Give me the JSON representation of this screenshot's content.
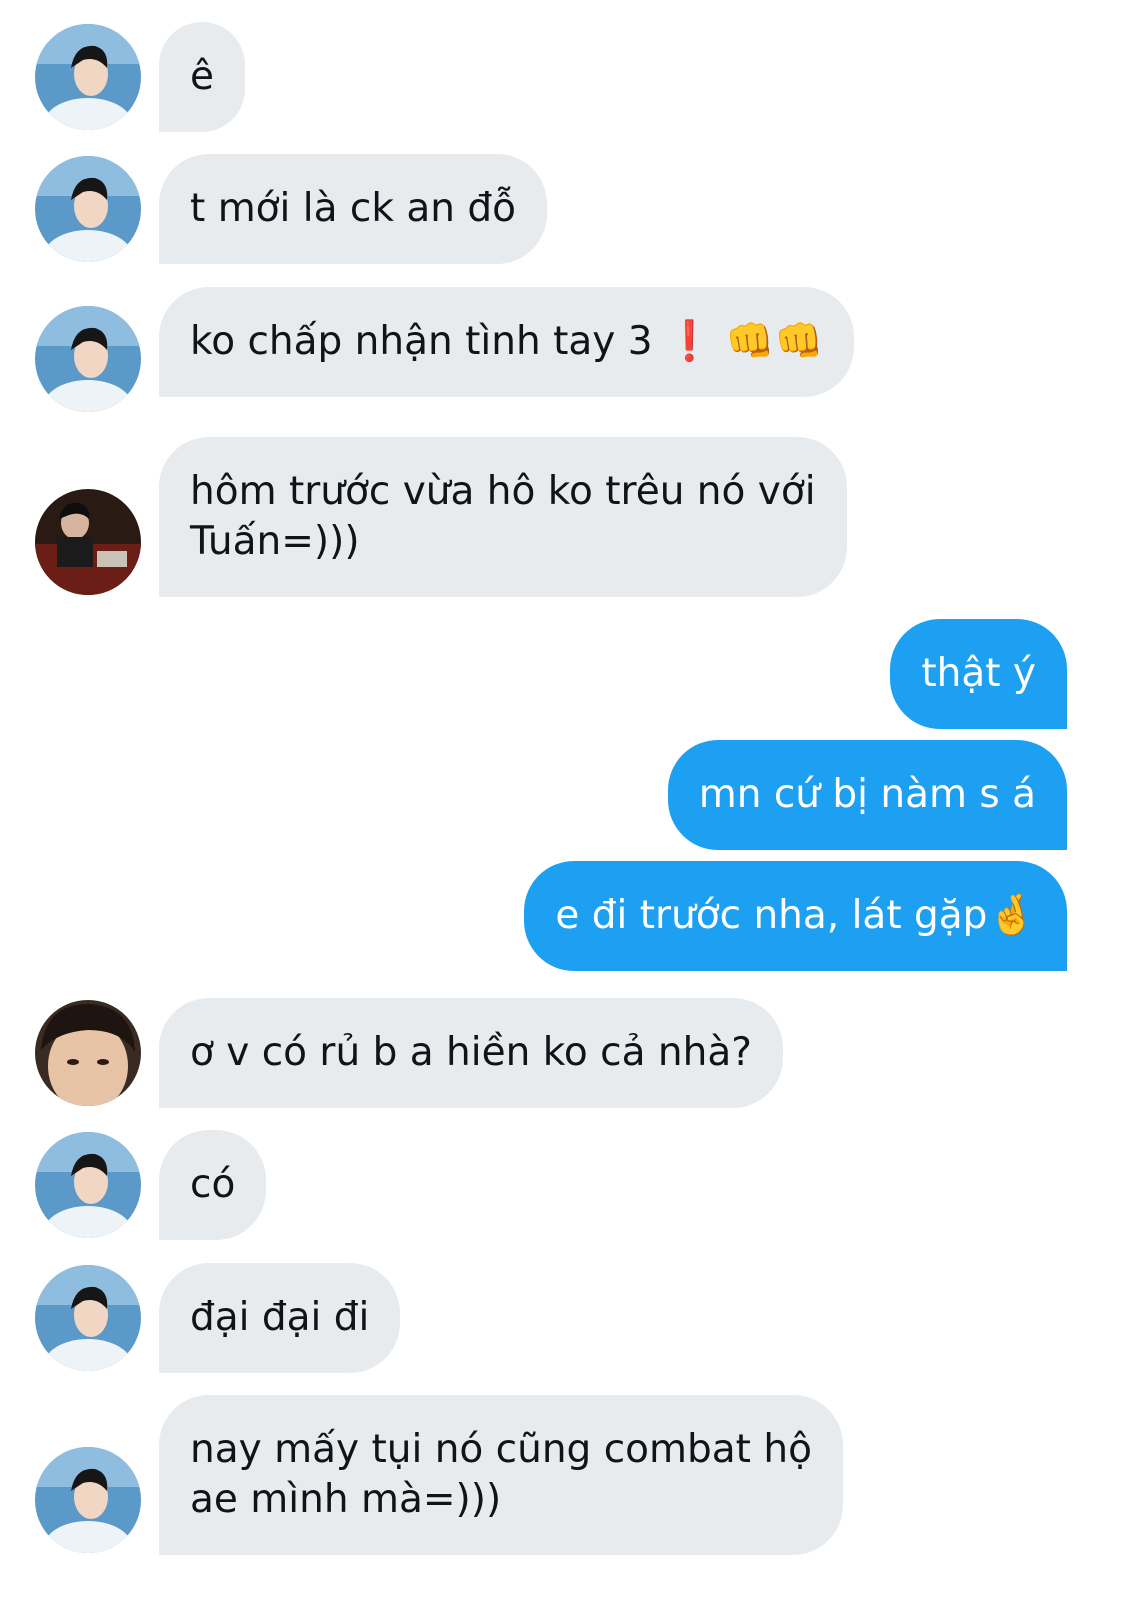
{
  "conversation": {
    "messages": [
      {
        "from": "friend-a",
        "text": "ê"
      },
      {
        "from": "friend-a",
        "text": "t mới là ck an đỗ"
      },
      {
        "from": "friend-a",
        "text": "ko chấp nhận tình tay 3",
        "emoji": "❗ 👊👊"
      },
      {
        "from": "friend-b",
        "lines": [
          "hôm trước vừa hô ko trêu nó với",
          "Tuấn=)))"
        ]
      },
      {
        "from": "me",
        "text": "thật ý"
      },
      {
        "from": "me",
        "text": "mn cứ bị nàm s á"
      },
      {
        "from": "me",
        "text": "e đi trước nha, lát gặp",
        "emoji": "🤞"
      },
      {
        "from": "friend-c",
        "text": "ơ v có rủ b a hiền ko cả nhà?"
      },
      {
        "from": "friend-a",
        "text": "có"
      },
      {
        "from": "friend-a",
        "text": "đại đại đi"
      },
      {
        "from": "friend-a",
        "lines": [
          "nay mấy tụi nó cũng combat hộ",
          "ae mình mà=)))"
        ]
      }
    ]
  },
  "colors": {
    "incoming_bubble": "#e7ebee",
    "outgoing_bubble": "#1da0f2",
    "incoming_text": "#0f1419",
    "outgoing_text": "#ffffff"
  }
}
